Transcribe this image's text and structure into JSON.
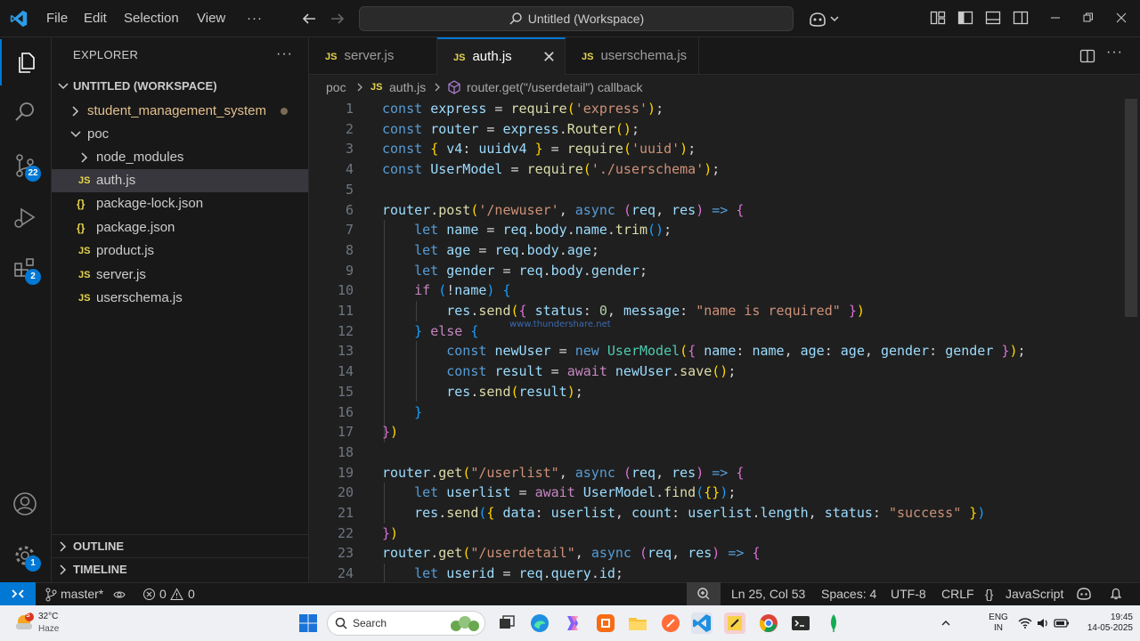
{
  "titlebar": {
    "menus": [
      "File",
      "Edit",
      "Selection",
      "View"
    ],
    "more": "···",
    "command_center": "Untitled (Workspace)"
  },
  "activity": {
    "source_control_badge": "22",
    "extensions_badge": "2",
    "settings_badge": "1"
  },
  "sidebar": {
    "title": "EXPLORER",
    "more": "···",
    "workspace": "UNTITLED (WORKSPACE)",
    "items": [
      {
        "label": "student_management_system",
        "type": "folder",
        "expanded": false,
        "depth": 1
      },
      {
        "label": "poc",
        "type": "folder",
        "expanded": true,
        "depth": 1
      },
      {
        "label": "node_modules",
        "type": "folder",
        "expanded": false,
        "depth": 2
      },
      {
        "label": "auth.js",
        "type": "js",
        "depth": 2,
        "selected": true
      },
      {
        "label": "package-lock.json",
        "type": "json",
        "depth": 2
      },
      {
        "label": "package.json",
        "type": "json",
        "depth": 2
      },
      {
        "label": "product.js",
        "type": "js",
        "depth": 2
      },
      {
        "label": "server.js",
        "type": "js",
        "depth": 2
      },
      {
        "label": "userschema.js",
        "type": "js",
        "depth": 2
      }
    ],
    "outline": "OUTLINE",
    "timeline": "TIMELINE"
  },
  "icons": {
    "js": "JS",
    "json": "{}"
  },
  "tabs": [
    {
      "label": "server.js",
      "active": false
    },
    {
      "label": "auth.js",
      "active": true
    },
    {
      "label": "userschema.js",
      "active": false
    }
  ],
  "breadcrumb": {
    "folder": "poc",
    "file": "auth.js",
    "symbol": "router.get(\"/userdetail\") callback"
  },
  "code": {
    "lines": [
      [
        [
          "kw",
          "const"
        ],
        [
          "pc",
          " "
        ],
        [
          "v",
          "express"
        ],
        [
          "pc",
          " = "
        ],
        [
          "fn",
          "require"
        ],
        [
          "br1",
          "("
        ],
        [
          "st",
          "'express'"
        ],
        [
          "br1",
          ")"
        ],
        [
          "pc",
          ";"
        ]
      ],
      [
        [
          "kw",
          "const"
        ],
        [
          "pc",
          " "
        ],
        [
          "v",
          "router"
        ],
        [
          "pc",
          " = "
        ],
        [
          "v",
          "express"
        ],
        [
          "pc",
          "."
        ],
        [
          "fn",
          "Router"
        ],
        [
          "br1",
          "()"
        ],
        [
          "pc",
          ";"
        ]
      ],
      [
        [
          "kw",
          "const"
        ],
        [
          "pc",
          " "
        ],
        [
          "br1",
          "{"
        ],
        [
          "pc",
          " "
        ],
        [
          "v",
          "v4"
        ],
        [
          "pc",
          ": "
        ],
        [
          "v",
          "uuidv4"
        ],
        [
          "pc",
          " "
        ],
        [
          "br1",
          "}"
        ],
        [
          "pc",
          " = "
        ],
        [
          "fn",
          "require"
        ],
        [
          "br1",
          "("
        ],
        [
          "st",
          "'uuid'"
        ],
        [
          "br1",
          ")"
        ],
        [
          "pc",
          ";"
        ]
      ],
      [
        [
          "kw",
          "const"
        ],
        [
          "pc",
          " "
        ],
        [
          "v",
          "UserModel"
        ],
        [
          "pc",
          " = "
        ],
        [
          "fn",
          "require"
        ],
        [
          "br1",
          "("
        ],
        [
          "st",
          "'./userschema'"
        ],
        [
          "br1",
          ")"
        ],
        [
          "pc",
          ";"
        ]
      ],
      [],
      [
        [
          "v",
          "router"
        ],
        [
          "pc",
          "."
        ],
        [
          "fn",
          "post"
        ],
        [
          "br1",
          "("
        ],
        [
          "st",
          "'/newuser'"
        ],
        [
          "pc",
          ", "
        ],
        [
          "kw",
          "async"
        ],
        [
          "pc",
          " "
        ],
        [
          "br2",
          "("
        ],
        [
          "v",
          "req"
        ],
        [
          "pc",
          ", "
        ],
        [
          "v",
          "res"
        ],
        [
          "br2",
          ")"
        ],
        [
          "pc",
          " "
        ],
        [
          "kw",
          "=>"
        ],
        [
          "pc",
          " "
        ],
        [
          "br2",
          "{"
        ]
      ],
      [
        [
          "pc",
          "    "
        ],
        [
          "kw",
          "let"
        ],
        [
          "pc",
          " "
        ],
        [
          "v",
          "name"
        ],
        [
          "pc",
          " = "
        ],
        [
          "v",
          "req"
        ],
        [
          "pc",
          "."
        ],
        [
          "v",
          "body"
        ],
        [
          "pc",
          "."
        ],
        [
          "v",
          "name"
        ],
        [
          "pc",
          "."
        ],
        [
          "fn",
          "trim"
        ],
        [
          "br3",
          "()"
        ],
        [
          "pc",
          ";"
        ]
      ],
      [
        [
          "pc",
          "    "
        ],
        [
          "kw",
          "let"
        ],
        [
          "pc",
          " "
        ],
        [
          "v",
          "age"
        ],
        [
          "pc",
          " = "
        ],
        [
          "v",
          "req"
        ],
        [
          "pc",
          "."
        ],
        [
          "v",
          "body"
        ],
        [
          "pc",
          "."
        ],
        [
          "v",
          "age"
        ],
        [
          "pc",
          ";"
        ]
      ],
      [
        [
          "pc",
          "    "
        ],
        [
          "kw",
          "let"
        ],
        [
          "pc",
          " "
        ],
        [
          "v",
          "gender"
        ],
        [
          "pc",
          " = "
        ],
        [
          "v",
          "req"
        ],
        [
          "pc",
          "."
        ],
        [
          "v",
          "body"
        ],
        [
          "pc",
          "."
        ],
        [
          "v",
          "gender"
        ],
        [
          "pc",
          ";"
        ]
      ],
      [
        [
          "pc",
          "    "
        ],
        [
          "kc",
          "if"
        ],
        [
          "pc",
          " "
        ],
        [
          "br3",
          "("
        ],
        [
          "pc",
          "!"
        ],
        [
          "v",
          "name"
        ],
        [
          "br3",
          ")"
        ],
        [
          "pc",
          " "
        ],
        [
          "br3",
          "{"
        ]
      ],
      [
        [
          "pc",
          "        "
        ],
        [
          "v",
          "res"
        ],
        [
          "pc",
          "."
        ],
        [
          "fn",
          "send"
        ],
        [
          "br1",
          "("
        ],
        [
          "br2",
          "{"
        ],
        [
          "pc",
          " "
        ],
        [
          "v",
          "status"
        ],
        [
          "pc",
          ": "
        ],
        [
          "nm",
          "0"
        ],
        [
          "pc",
          ", "
        ],
        [
          "v",
          "message"
        ],
        [
          "pc",
          ": "
        ],
        [
          "st",
          "\"name is required\""
        ],
        [
          "pc",
          " "
        ],
        [
          "br2",
          "}"
        ],
        [
          "br1",
          ")"
        ]
      ],
      [
        [
          "pc",
          "    "
        ],
        [
          "br3",
          "}"
        ],
        [
          "pc",
          " "
        ],
        [
          "kc",
          "else"
        ],
        [
          "pc",
          " "
        ],
        [
          "br3",
          "{"
        ]
      ],
      [
        [
          "pc",
          "        "
        ],
        [
          "kw",
          "const"
        ],
        [
          "pc",
          " "
        ],
        [
          "v",
          "newUser"
        ],
        [
          "pc",
          " = "
        ],
        [
          "kw",
          "new"
        ],
        [
          "pc",
          " "
        ],
        [
          "cl",
          "UserModel"
        ],
        [
          "br1",
          "("
        ],
        [
          "br2",
          "{"
        ],
        [
          "pc",
          " "
        ],
        [
          "v",
          "name"
        ],
        [
          "pc",
          ": "
        ],
        [
          "v",
          "name"
        ],
        [
          "pc",
          ", "
        ],
        [
          "v",
          "age"
        ],
        [
          "pc",
          ": "
        ],
        [
          "v",
          "age"
        ],
        [
          "pc",
          ", "
        ],
        [
          "v",
          "gender"
        ],
        [
          "pc",
          ": "
        ],
        [
          "v",
          "gender"
        ],
        [
          "pc",
          " "
        ],
        [
          "br2",
          "}"
        ],
        [
          "br1",
          ")"
        ],
        [
          "pc",
          ";"
        ]
      ],
      [
        [
          "pc",
          "        "
        ],
        [
          "kw",
          "const"
        ],
        [
          "pc",
          " "
        ],
        [
          "v",
          "result"
        ],
        [
          "pc",
          " = "
        ],
        [
          "kc",
          "await"
        ],
        [
          "pc",
          " "
        ],
        [
          "v",
          "newUser"
        ],
        [
          "pc",
          "."
        ],
        [
          "fn",
          "save"
        ],
        [
          "br1",
          "()"
        ],
        [
          "pc",
          ";"
        ]
      ],
      [
        [
          "pc",
          "        "
        ],
        [
          "v",
          "res"
        ],
        [
          "pc",
          "."
        ],
        [
          "fn",
          "send"
        ],
        [
          "br1",
          "("
        ],
        [
          "v",
          "result"
        ],
        [
          "br1",
          ")"
        ],
        [
          "pc",
          ";"
        ]
      ],
      [
        [
          "pc",
          "    "
        ],
        [
          "br3",
          "}"
        ]
      ],
      [
        [
          "br2",
          "}"
        ],
        [
          "br1",
          ")"
        ]
      ],
      [],
      [
        [
          "v",
          "router"
        ],
        [
          "pc",
          "."
        ],
        [
          "fn",
          "get"
        ],
        [
          "br1",
          "("
        ],
        [
          "st",
          "\"/userlist\""
        ],
        [
          "pc",
          ", "
        ],
        [
          "kw",
          "async"
        ],
        [
          "pc",
          " "
        ],
        [
          "br2",
          "("
        ],
        [
          "v",
          "req"
        ],
        [
          "pc",
          ", "
        ],
        [
          "v",
          "res"
        ],
        [
          "br2",
          ")"
        ],
        [
          "pc",
          " "
        ],
        [
          "kw",
          "=>"
        ],
        [
          "pc",
          " "
        ],
        [
          "br2",
          "{"
        ]
      ],
      [
        [
          "pc",
          "    "
        ],
        [
          "kw",
          "let"
        ],
        [
          "pc",
          " "
        ],
        [
          "v",
          "userlist"
        ],
        [
          "pc",
          " = "
        ],
        [
          "kc",
          "await"
        ],
        [
          "pc",
          " "
        ],
        [
          "v",
          "UserModel"
        ],
        [
          "pc",
          "."
        ],
        [
          "fn",
          "find"
        ],
        [
          "br3",
          "("
        ],
        [
          "br1",
          "{}"
        ],
        [
          "br3",
          ")"
        ],
        [
          "pc",
          ";"
        ]
      ],
      [
        [
          "pc",
          "    "
        ],
        [
          "v",
          "res"
        ],
        [
          "pc",
          "."
        ],
        [
          "fn",
          "send"
        ],
        [
          "br3",
          "("
        ],
        [
          "br1",
          "{"
        ],
        [
          "pc",
          " "
        ],
        [
          "v",
          "data"
        ],
        [
          "pc",
          ": "
        ],
        [
          "v",
          "userlist"
        ],
        [
          "pc",
          ", "
        ],
        [
          "v",
          "count"
        ],
        [
          "pc",
          ": "
        ],
        [
          "v",
          "userlist"
        ],
        [
          "pc",
          "."
        ],
        [
          "v",
          "length"
        ],
        [
          "pc",
          ", "
        ],
        [
          "v",
          "status"
        ],
        [
          "pc",
          ": "
        ],
        [
          "st",
          "\"success\""
        ],
        [
          "pc",
          " "
        ],
        [
          "br1",
          "}"
        ],
        [
          "br3",
          ")"
        ]
      ],
      [
        [
          "br2",
          "}"
        ],
        [
          "br1",
          ")"
        ]
      ],
      [
        [
          "v",
          "router"
        ],
        [
          "pc",
          "."
        ],
        [
          "fn",
          "get"
        ],
        [
          "br1",
          "("
        ],
        [
          "st",
          "\"/userdetail\""
        ],
        [
          "pc",
          ", "
        ],
        [
          "kw",
          "async"
        ],
        [
          "pc",
          " "
        ],
        [
          "br2",
          "("
        ],
        [
          "v",
          "req"
        ],
        [
          "pc",
          ", "
        ],
        [
          "v",
          "res"
        ],
        [
          "br2",
          ")"
        ],
        [
          "pc",
          " "
        ],
        [
          "kw",
          "=>"
        ],
        [
          "pc",
          " "
        ],
        [
          "br2",
          "{"
        ]
      ],
      [
        [
          "pc",
          "    "
        ],
        [
          "kw",
          "let"
        ],
        [
          "pc",
          " "
        ],
        [
          "v",
          "userid"
        ],
        [
          "pc",
          " = "
        ],
        [
          "v",
          "req"
        ],
        [
          "pc",
          "."
        ],
        [
          "v",
          "query"
        ],
        [
          "pc",
          "."
        ],
        [
          "v",
          "id"
        ],
        [
          "pc",
          ";"
        ]
      ]
    ],
    "watermark": "www.thundershare.net"
  },
  "statusbar": {
    "branch": "master*",
    "errors": "0",
    "warnings": "0",
    "position": "Ln 25, Col 53",
    "spaces": "Spaces: 4",
    "encoding": "UTF-8",
    "eol": "CRLF",
    "language": "JavaScript",
    "language_icon": "{}"
  },
  "taskbar": {
    "temp": "32°C",
    "weather": "Haze",
    "weather_badge": "S",
    "search": "Search",
    "lang1": "ENG",
    "lang2": "IN",
    "time": "19:45",
    "date": "14-05-2025"
  },
  "colors": {
    "accent": "#0078d4",
    "background": "#1f1f1f",
    "sidebar": "#181818"
  }
}
